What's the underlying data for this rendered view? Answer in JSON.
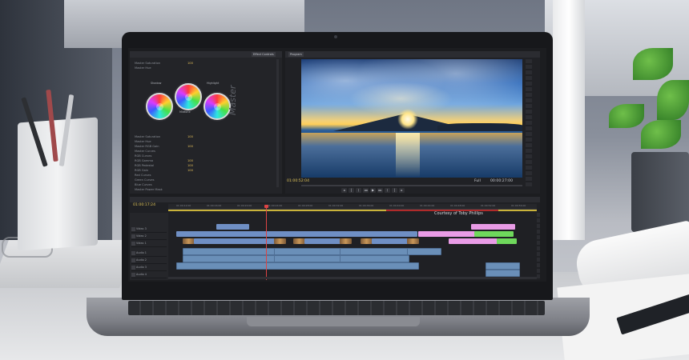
{
  "app": {
    "left_panel_tabs": [
      "",
      "Effect Controls"
    ],
    "monitor_tab": "Program"
  },
  "color_panel": {
    "master_label": "Master",
    "wheels": [
      {
        "name": "Shadow"
      },
      {
        "name": "Midtone"
      },
      {
        "name": "Highlight"
      }
    ],
    "tree_items": [
      {
        "label": "Master Saturation",
        "value": "100"
      },
      {
        "label": "Master Hue",
        "value": ""
      },
      {
        "label": "Master RGB Gain",
        "value": "100"
      },
      {
        "label": "Master Curves",
        "value": ""
      },
      {
        "label": "RGB Curves",
        "value": ""
      },
      {
        "label": "RGB Gamma",
        "value": "100"
      },
      {
        "label": "RGB Pedestal",
        "value": "100"
      },
      {
        "label": "RGB Gain",
        "value": "100"
      },
      {
        "label": "Red Curves",
        "value": ""
      },
      {
        "label": "Green Curves",
        "value": ""
      },
      {
        "label": "Blue Curves",
        "value": ""
      },
      {
        "label": "Master Power Mask",
        "value": ""
      }
    ]
  },
  "program_monitor": {
    "timecode_current": "01:00:52:04",
    "timecode_duration": "00:00:27:00",
    "fit": "Full",
    "transport": [
      "◂",
      "|",
      "⟨",
      "◂◂",
      "▶",
      "▸▸",
      "⟩",
      "|",
      "▸"
    ]
  },
  "timeline": {
    "current_time": "01:00:17:24",
    "ruler_ticks": [
      "01:00:12:00",
      "01:00:16:00",
      "01:00:20:00",
      "01:00:24:00",
      "01:00:28:00",
      "01:00:32:00",
      "01:00:36:00",
      "01:00:40:00",
      "01:00:44:00",
      "01:00:48:00",
      "01:00:52:00",
      "01:00:56:00"
    ],
    "courtesy_text": "Courtesy of Toby Phillips",
    "tracks": [
      {
        "label": "Video 3"
      },
      {
        "label": "Video 2"
      },
      {
        "label": "Video 1"
      },
      {
        "label": "Audio 1"
      },
      {
        "label": "Audio 2"
      },
      {
        "label": "Audio 3"
      },
      {
        "label": "Audio 4"
      }
    ]
  }
}
